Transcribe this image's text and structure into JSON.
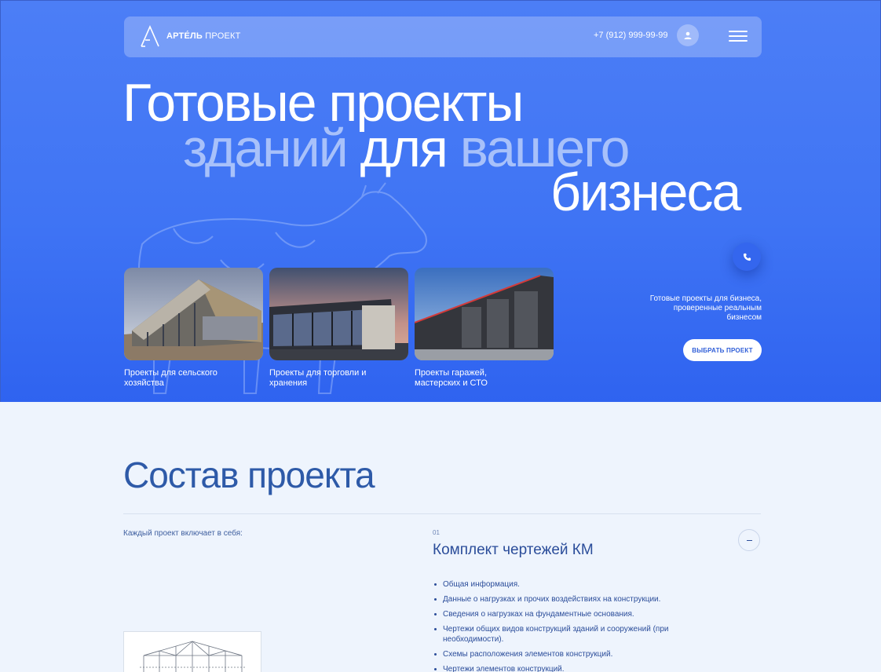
{
  "header": {
    "logo_bold": "АРТЕ́ЛЬ",
    "logo_light": "ПРОЕКТ",
    "phone": "+7 (912) 999-99-99",
    "icons": [
      "logo-icon",
      "user-icon",
      "menu-icon"
    ]
  },
  "hero": {
    "line1": "Готовые проекты",
    "line2_a": "зданий",
    "line2_b": "для",
    "line2_c": "вашего",
    "line3": "бизнеса",
    "side_text": "Готовые проекты для бизнеса, проверенные реальным бизнесом",
    "choose_button": "ВЫБРАТЬ ПРОЕКТ",
    "cards": [
      {
        "caption": "Проекты для сельского хозяйства"
      },
      {
        "caption": "Проекты для торговли и хранения"
      },
      {
        "caption": "Проекты гаражей, мастерских и СТО"
      }
    ]
  },
  "composition": {
    "title": "Состав проекта",
    "includes": "Каждый проект включает в себя:",
    "item_number": "01",
    "item_title": "Комплект чертежей КМ",
    "items": [
      "Общая информация.",
      "Данные о нагрузках и прочих воздействиях на конструкции.",
      "Сведения о нагрузках на фундаментные основания.",
      "Чертежи общих видов конструкций зданий и сооружений (при необходимости).",
      "Схемы расположения элементов конструкций.",
      "Чертежи элементов конструкций."
    ]
  },
  "colors": {
    "accent": "#3f74f4",
    "text_dark": "#2b4d9a",
    "bg_light": "#eef4fd"
  }
}
